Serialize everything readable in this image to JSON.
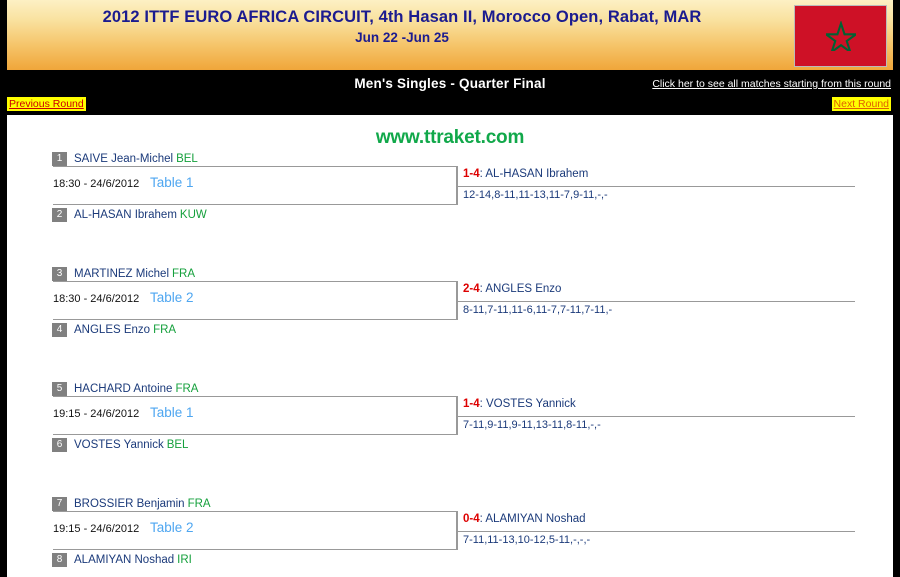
{
  "header": {
    "tournament_title": "2012 ITTF EURO AFRICA CIRCUIT, 4th Hasan II, Morocco Open, Rabat, MAR",
    "dates": "Jun 22 -Jun 25",
    "flag_icon": "morocco-flag-icon",
    "flag_color": "#ce1126",
    "flag_star_color": "#006233"
  },
  "nav": {
    "round_title": "Men's Singles - Quarter Final",
    "all_matches_link": "Click her to see all matches starting from this round",
    "previous_round": "Previous Round",
    "next_round": "Next Round"
  },
  "watermark": "www.ttraket.com",
  "matches": [
    {
      "top": {
        "seed": "1",
        "name": "SAIVE Jean-Michel",
        "assoc": "BEL"
      },
      "bottom": {
        "seed": "2",
        "name": "AL-HASAN Ibrahem",
        "assoc": "KUW"
      },
      "time": "18:30 - 24/6/2012",
      "table": "Table 1",
      "score": "1-4",
      "winner": ": AL-HASAN Ibrahem",
      "sets": "12-14,8-11,11-13,11-7,9-11,-,-"
    },
    {
      "top": {
        "seed": "3",
        "name": "MARTINEZ Michel",
        "assoc": "FRA"
      },
      "bottom": {
        "seed": "4",
        "name": "ANGLES Enzo",
        "assoc": "FRA"
      },
      "time": "18:30 - 24/6/2012",
      "table": "Table 2",
      "score": "2-4",
      "winner": ": ANGLES Enzo",
      "sets": "8-11,7-11,11-6,11-7,7-11,7-11,-"
    },
    {
      "top": {
        "seed": "5",
        "name": "HACHARD Antoine",
        "assoc": "FRA"
      },
      "bottom": {
        "seed": "6",
        "name": "VOSTES Yannick",
        "assoc": "BEL"
      },
      "time": "19:15 - 24/6/2012",
      "table": "Table 1",
      "score": "1-4",
      "winner": ": VOSTES Yannick",
      "sets": "7-11,9-11,9-11,13-11,8-11,-,-"
    },
    {
      "top": {
        "seed": "7",
        "name": "BROSSIER Benjamin",
        "assoc": "FRA"
      },
      "bottom": {
        "seed": "8",
        "name": "ALAMIYAN Noshad",
        "assoc": "IRI"
      },
      "time": "19:15 - 24/6/2012",
      "table": "Table 2",
      "score": "0-4",
      "winner": ": ALAMIYAN Noshad",
      "sets": "7-11,11-13,10-12,5-11,-,-,-"
    }
  ]
}
